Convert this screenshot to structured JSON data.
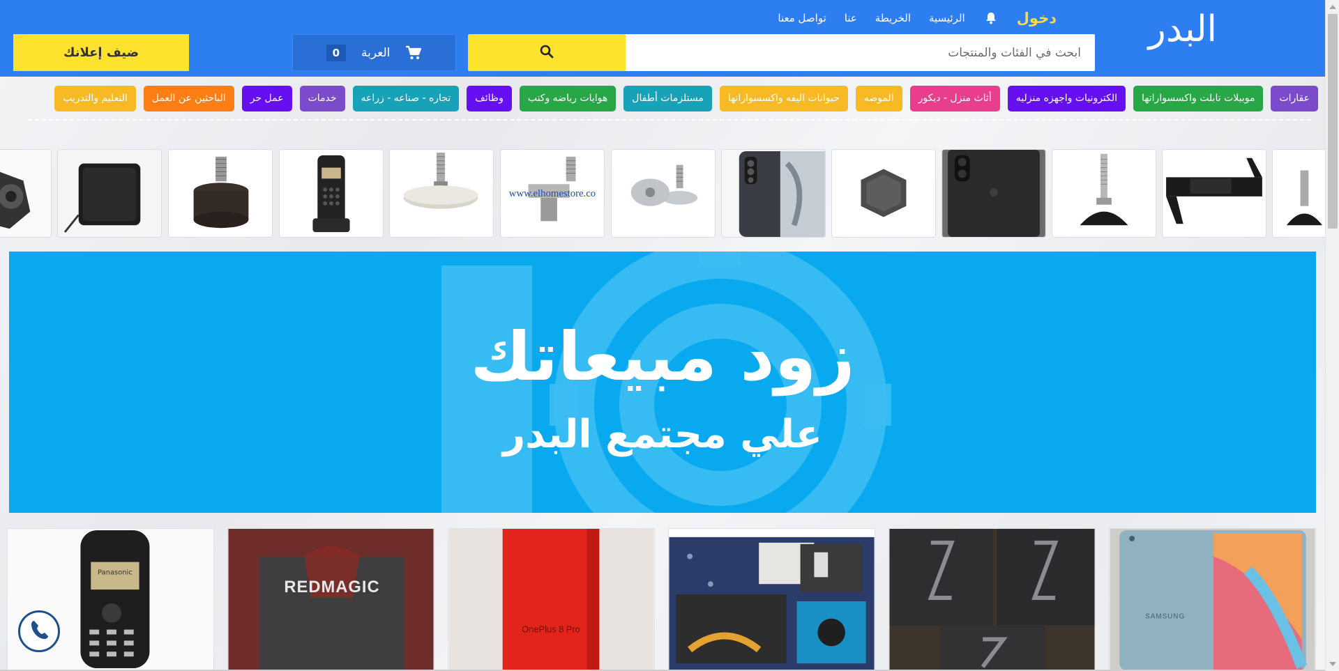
{
  "header": {
    "logo": "البدر",
    "login": "دخول",
    "nav": [
      "الرئيسية",
      "الخريطة",
      "عنا",
      "تواصل معنا"
    ],
    "search_placeholder": "ابحث في الفئات والمنتجات",
    "cart_label": "العربة",
    "cart_count": "0",
    "add_ad": "ضيف إعلانك",
    "colors": {
      "bar": "#2d7ef1",
      "accent": "#fde32e"
    }
  },
  "categories": [
    {
      "label": "عقارات",
      "color": "#7b4bcb"
    },
    {
      "label": "موبيلات تابلت واكسسواراتها",
      "color": "#27a745"
    },
    {
      "label": "الكترونيات واجهزه منزليه",
      "color": "#6610f2"
    },
    {
      "label": "أثاث منزل - ديكور",
      "color": "#e83e8c"
    },
    {
      "label": "الموضه",
      "color": "#f7b924"
    },
    {
      "label": "حيوانات اليفه واكسسواراتها",
      "color": "#f7b924"
    },
    {
      "label": "مستلزمات أطفال",
      "color": "#17a2b8"
    },
    {
      "label": "هوايات رياضه وكتب",
      "color": "#27a745"
    },
    {
      "label": "وظائف",
      "color": "#6610f2"
    },
    {
      "label": "تجاره - صناعه - زراعه",
      "color": "#17a2b8"
    },
    {
      "label": "خدمات",
      "color": "#7b4bcb"
    },
    {
      "label": "عمل حر",
      "color": "#6610f2"
    },
    {
      "label": "الباحثين عن العمل",
      "color": "#fd7e14"
    },
    {
      "label": "التعليم والتدريب",
      "color": "#f7b924"
    }
  ],
  "strip_items": [
    "thumb-part",
    "thumb-strap",
    "thumb-foot-screw",
    "thumb-iphone",
    "thumb-hex-nut",
    "thumb-galaxy",
    "thumb-foot-pair",
    "thumb-bolt-store",
    "thumb-foot-round",
    "thumb-panasonic-phone",
    "thumb-foot-screw-black",
    "thumb-charger",
    "thumb-part-dark"
  ],
  "strip_watermark": "www.elhomestore.co",
  "banner": {
    "line1": "زود مبيعاتك",
    "line2": "علي مجتمع البدر"
  },
  "products": [
    {
      "name": "panasonic-phone",
      "screen_text": "Panasonic"
    },
    {
      "name": "redmagic-box",
      "brand": "REDMAGIC"
    },
    {
      "name": "oneplus-box",
      "brand": "OnePlus 8 Pro"
    },
    {
      "name": "accessory-bundle"
    },
    {
      "name": "zfold-boxes"
    },
    {
      "name": "samsung-tablet",
      "brand": "SAMSUNG"
    }
  ]
}
